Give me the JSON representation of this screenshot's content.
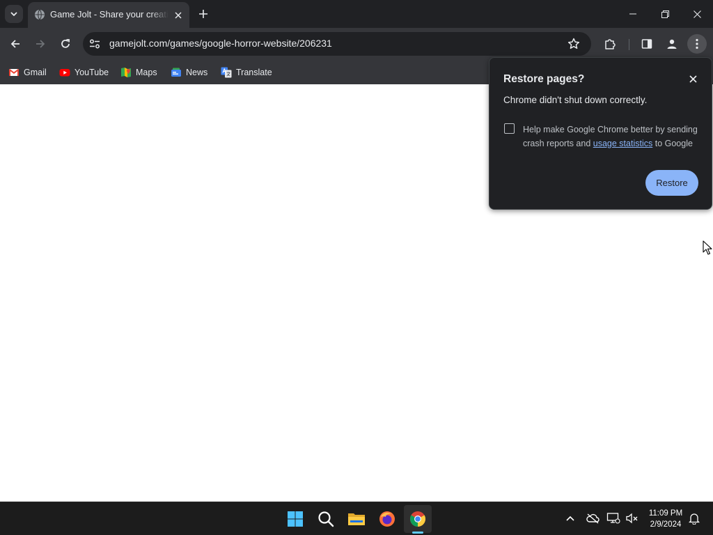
{
  "window": {
    "tab": {
      "title": "Game Jolt - Share your creations",
      "favicon": "globe-icon"
    },
    "controls": [
      "minimize-icon",
      "restore-icon",
      "close-icon"
    ]
  },
  "toolbar": {
    "url": "gamejolt.com/games/google-horror-website/206231",
    "icons": [
      "back-arrow-icon",
      "forward-arrow-icon",
      "reload-icon",
      "site-info-icon",
      "bookmark-star-icon",
      "extensions-puzzle-icon",
      "side-panel-icon",
      "profile-icon",
      "kebab-menu-icon"
    ]
  },
  "bookmarks": [
    {
      "label": "Gmail",
      "icon": "gmail-icon"
    },
    {
      "label": "YouTube",
      "icon": "youtube-icon"
    },
    {
      "label": "Maps",
      "icon": "maps-icon"
    },
    {
      "label": "News",
      "icon": "news-icon"
    },
    {
      "label": "Translate",
      "icon": "translate-icon"
    }
  ],
  "restore_bubble": {
    "title": "Restore pages?",
    "message": "Chrome didn't shut down correctly.",
    "checkbox_text_before": "Help make Google Chrome better by sending crash reports and",
    "checkbox_link": "usage statistics",
    "checkbox_text_after": "to Google",
    "checkbox_checked": false,
    "restore_label": "Restore"
  },
  "taskbar": {
    "apps": [
      "windows-start-icon",
      "search-icon",
      "file-explorer-icon",
      "firefox-icon",
      "chrome-icon"
    ],
    "active_app": "chrome-icon",
    "time": "11:09 PM",
    "date": "2/9/2024"
  },
  "colors": {
    "tabstrip": "#202124",
    "toolbar": "#35363a",
    "accent": "#8ab4f8",
    "taskbar": "#1c1c1c"
  }
}
